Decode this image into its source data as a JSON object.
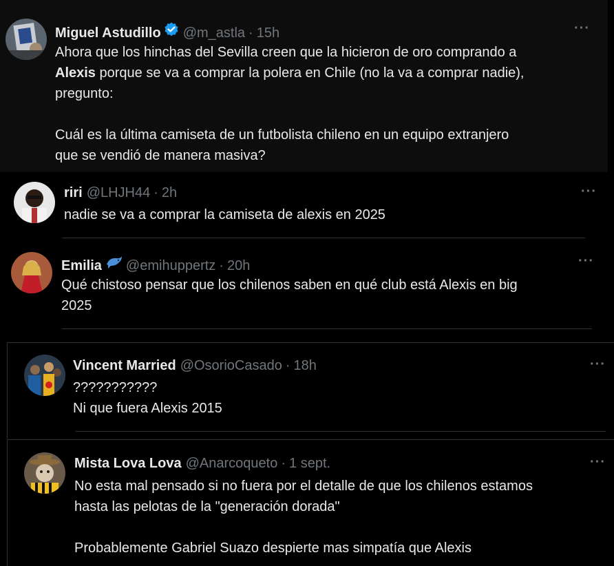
{
  "tweets": [
    {
      "name": "Miguel Astudillo",
      "handle": "@m_astla",
      "dot": "·",
      "time": "15h",
      "more": "···",
      "lines": {
        "l1": "Ahora que los hinchas del Sevilla creen que la hicieron de oro comprando a",
        "l2_bold": "Alexis",
        "l2_rest": " porque se va a comprar la polera en Chile (no la va a comprar nadie),",
        "l3": "pregunto:",
        "l4": "Cuál es la última camiseta de un futbolista chileno en un equipo extranjero",
        "l5": "que se vendió de manera masiva?"
      }
    },
    {
      "name": "riri",
      "handle": "@LHJH44",
      "dot": "·",
      "time": "2h",
      "more": "···",
      "lines": {
        "l1": "nadie se va a comprar la camiseta de alexis en 2025"
      }
    },
    {
      "name": "Emilia",
      "handle": "@emihuppertz",
      "dot": "·",
      "time": "20h",
      "more": "···",
      "lines": {
        "l1": "Qué chistoso pensar que los chilenos saben en qué club está Alexis en big",
        "l2": "2025"
      }
    },
    {
      "name": "Vincent Married",
      "handle": "@OsorioCasado",
      "dot": "·",
      "time": "18h",
      "more": "···",
      "lines": {
        "l1": "???????????",
        "l2": "Ni que fuera Alexis 2015"
      }
    },
    {
      "name": "Mista Lova Lova",
      "handle": "@Anarcoqueto",
      "dot": "·",
      "time": "1 sept.",
      "more": "···",
      "lines": {
        "l1": "No esta mal pensado si no fuera por el detalle de que los chilenos estamos",
        "l2": "hasta las pelotas de la \"generación dorada\"",
        "l3": "Probablemente Gabriel Suazo despierte mas simpatía que Alexis"
      }
    }
  ],
  "colors": {
    "background": "#000000",
    "text": "#e7e9ea",
    "muted": "#71767b",
    "verified": "#1d9bf0",
    "divider": "#2f3336"
  },
  "icons": {
    "verified": "verified-badge-icon",
    "dolphin": "dolphin-emoji-icon",
    "more": "more-options-icon"
  }
}
